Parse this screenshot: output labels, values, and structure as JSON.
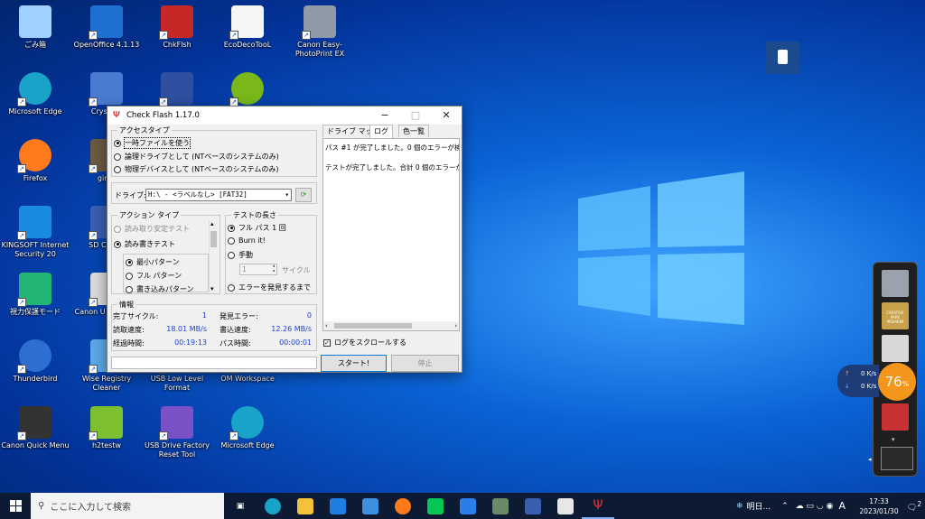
{
  "desktop_icons": [
    {
      "id": "recycle",
      "label": "ごみ箱",
      "icon": "recycle-bin-icon",
      "color": "#9fd0ff"
    },
    {
      "id": "openoffice",
      "label": "OpenOffice 4.1.13",
      "icon": "openoffice-icon",
      "color": "#1f6fd1"
    },
    {
      "id": "chkflsh",
      "label": "ChkFlsh",
      "icon": "usb-icon",
      "color": "#c62828"
    },
    {
      "id": "ecodeco",
      "label": "EcoDecoTooL",
      "icon": "ecodeco-icon",
      "color": "#f5f5f5"
    },
    {
      "id": "canon-epp",
      "label": "Canon Easy-PhotoPrint EX",
      "icon": "printer-icon",
      "color": "#8e9aa6"
    },
    {
      "id": "edge1",
      "label": "Microsoft Edge",
      "icon": "edge-icon",
      "color": "#1aa3c8"
    },
    {
      "id": "crystal",
      "label": "CrystalD",
      "icon": "crystaldisk-icon",
      "color": "#4a7bd0"
    },
    {
      "id": "tb",
      "label": "",
      "icon": "tb-icon",
      "color": "#2f4fa0"
    },
    {
      "id": "disc",
      "label": "",
      "icon": "disc-icon",
      "color": "#79b818"
    },
    {
      "id": "firefox",
      "label": "Firefox",
      "icon": "firefox-icon",
      "color": "#ff7a1a"
    },
    {
      "id": "gimp",
      "label": "gimp",
      "icon": "gimp-icon",
      "color": "#6b5a44"
    },
    {
      "id": "kingsoft",
      "label": "KINGSOFT Internet Security 20",
      "icon": "kingsoft-icon",
      "color": "#1a8be0"
    },
    {
      "id": "sdcard",
      "label": "SD Card F",
      "icon": "sdcard-icon",
      "color": "#3a5fb0"
    },
    {
      "id": "eye",
      "label": "視力保護モード",
      "icon": "eye-icon",
      "color": "#22b573"
    },
    {
      "id": "canonu",
      "label": "Canon U series 等",
      "icon": "canon-icon",
      "color": "#d9d9d9"
    },
    {
      "id": "thunderbird",
      "label": "Thunderbird",
      "icon": "thunderbird-icon",
      "color": "#2d6fd0"
    },
    {
      "id": "wiseregistry",
      "label": "Wise Registry Cleaner",
      "icon": "wise-icon",
      "color": "#5ca8e8"
    },
    {
      "id": "usblowlevel",
      "label": "USB Low Level Format",
      "icon": "usb-format-icon",
      "color": "#2b3f6b"
    },
    {
      "id": "omworkspace",
      "label": "OM Workspace",
      "icon": "om-icon",
      "color": "#222"
    },
    {
      "id": "canonquick",
      "label": "Canon Quick Menu",
      "icon": "canon-menu-icon",
      "color": "#333"
    },
    {
      "id": "h2testw",
      "label": "h2testw",
      "icon": "h2testw-icon",
      "color": "#7cbf2f"
    },
    {
      "id": "usbfactory",
      "label": "USB Drive Factory Reset Tool",
      "icon": "usb-reset-icon",
      "color": "#7a52c7"
    },
    {
      "id": "edge2",
      "label": "Microsoft Edge",
      "icon": "edge-icon",
      "color": "#1aa3c8"
    }
  ],
  "window": {
    "title": "Check Flash 1.17.0",
    "access_type": {
      "legend": "アクセスタイプ",
      "options": [
        "一時ファイルを使う",
        "論理ドライブとして (NTベースのシステムのみ)",
        "物理デバイスとして (NTベースのシステムのみ)"
      ],
      "selected": 0
    },
    "drive_label": "ドライブ:",
    "drive_value": "H:\\ - <ラベルなし> [FAT32]",
    "action_type": {
      "legend": "アクション タイプ",
      "options": [
        "読み取り安定テスト",
        "読み書きテスト"
      ],
      "selected": 1,
      "sub_options": [
        "最小パターン",
        "フル パターン",
        "書き込みパターン"
      ],
      "sub_selected": 0
    },
    "test_length": {
      "legend": "テストの長さ",
      "options": [
        "フル パス 1 回",
        "Burn it!",
        "手動"
      ],
      "selected": 0,
      "spin_value": "1",
      "cycles_label": "サイクル",
      "until_error": "エラーを発見するまで"
    },
    "info": {
      "legend": "情報",
      "done_cycles_label": "完了サイクル:",
      "done_cycles": "1",
      "errors_label": "発見エラー:",
      "errors": "0",
      "read_speed_label": "読取速度:",
      "read_speed": "18.01 MB/s",
      "write_speed_label": "書込速度:",
      "write_speed": "12.26 MB/s",
      "elapsed_label": "経過時間:",
      "elapsed": "00:19:13",
      "pass_label": "パス時間:",
      "pass_time": "00:00:01"
    },
    "tabs": [
      "ドライブ マップ",
      "ログ",
      "色一覧"
    ],
    "active_tab": 1,
    "log_lines": [
      "パス #1 が完了しました。0 個のエラーが検",
      "テストが完了しました。合計 0 個のエラーが"
    ],
    "scroll_log_label": "ログをスクロールする",
    "start_button": "スタート!",
    "stop_button": "停止"
  },
  "widgets": {
    "net_up": "0 K/s",
    "net_down": "0 K/s",
    "cpu_percent": "76",
    "percent_sign": "%",
    "creative_park": "CREATIVE PARK PREMIUM"
  },
  "taskbar": {
    "search_placeholder": "ここに入力して検索",
    "weather": "明日...",
    "ime": "A",
    "time": "17:33",
    "date": "2023/01/30",
    "notifications": "2"
  }
}
